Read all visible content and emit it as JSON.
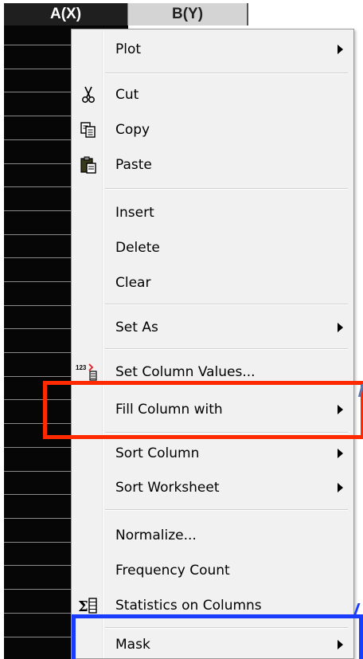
{
  "worksheet": {
    "col_a_header": "A(X)",
    "col_b_header": "B(Y)"
  },
  "menu": {
    "items": [
      {
        "label": "Plot",
        "submenu": true,
        "icon": ""
      },
      {
        "label": "Cut",
        "submenu": false,
        "icon": "scissors-icon"
      },
      {
        "label": "Copy",
        "submenu": false,
        "icon": "copy-icon"
      },
      {
        "label": "Paste",
        "submenu": false,
        "icon": "paste-icon"
      },
      {
        "label": "Insert",
        "submenu": false,
        "icon": ""
      },
      {
        "label": "Delete",
        "submenu": false,
        "icon": ""
      },
      {
        "label": "Clear",
        "submenu": false,
        "icon": ""
      },
      {
        "label": "Set As",
        "submenu": true,
        "icon": ""
      },
      {
        "label": "Set Column Values...",
        "submenu": false,
        "icon": "set-values-icon"
      },
      {
        "label": "Fill Column with",
        "submenu": true,
        "icon": ""
      },
      {
        "label": "Sort Column",
        "submenu": true,
        "icon": ""
      },
      {
        "label": "Sort Worksheet",
        "submenu": true,
        "icon": ""
      },
      {
        "label": "Normalize...",
        "submenu": false,
        "icon": ""
      },
      {
        "label": "Frequency Count",
        "submenu": false,
        "icon": ""
      },
      {
        "label": "Statistics on Columns",
        "submenu": false,
        "icon": "statistics-icon"
      },
      {
        "label": "Mask",
        "submenu": true,
        "icon": ""
      }
    ],
    "set_values_icon_text": "123"
  },
  "colors": {
    "red_highlight": "#ff2a00",
    "blue_highlight": "#1a3cff",
    "menu_background": "#f1f1f1",
    "selected_column": "#060606"
  }
}
